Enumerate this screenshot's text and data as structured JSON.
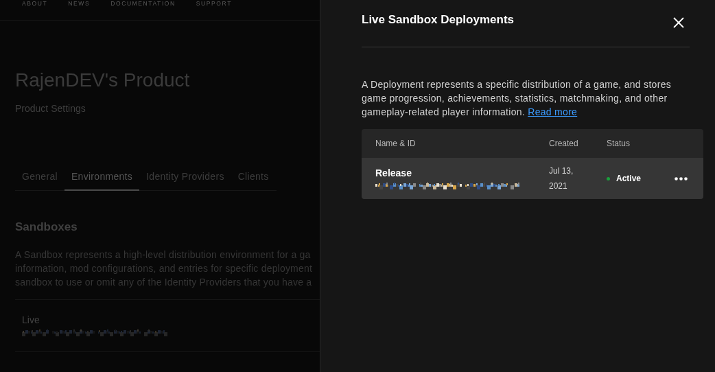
{
  "nav": {
    "items": [
      "ABOUT",
      "NEWS",
      "DOCUMENTATION",
      "SUPPORT"
    ]
  },
  "product": {
    "title": "RajenDEV's Product",
    "subtitle": "Product Settings"
  },
  "tabs": [
    {
      "label": "General",
      "selected": false
    },
    {
      "label": "Environments",
      "selected": true
    },
    {
      "label": "Identity Providers",
      "selected": false
    },
    {
      "label": "Clients",
      "selected": false
    }
  ],
  "sandboxes": {
    "heading": "Sandboxes",
    "description_lines": [
      "A Sandbox represents a high-level distribution environment for a ga",
      "information, mod configurations, and entries for specific deployment",
      "sandbox to use or omit any of the Identity Providers that you have a"
    ],
    "items": [
      {
        "name": "Live"
      }
    ]
  },
  "drawer": {
    "title": "Live Sandbox Deployments",
    "description": "A Deployment represents a specific distribution of a game, and stores game progression, achievements, statistics, matchmaking, and other gameplay-related player information.",
    "link": "Read more",
    "table": {
      "columns": [
        "Name & ID",
        "Created",
        "Status"
      ],
      "rows": [
        {
          "name": "Release",
          "created": "Jul 13, 2021",
          "status": "Active",
          "color": "#1a9f3c"
        }
      ]
    }
  }
}
